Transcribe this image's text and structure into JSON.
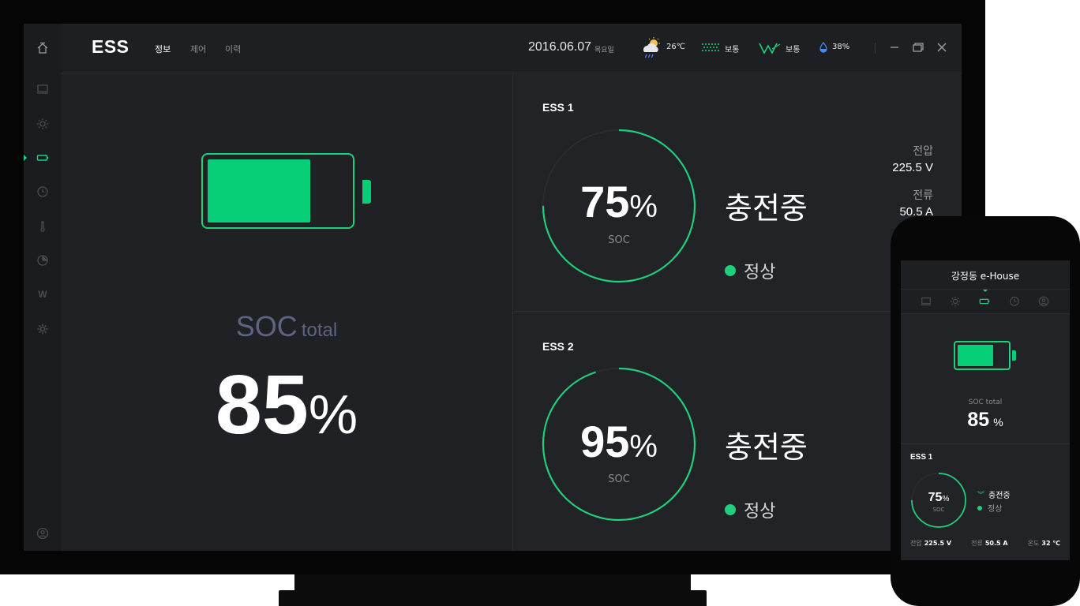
{
  "header": {
    "title": "ESS",
    "tabs": [
      {
        "label": "정보",
        "active": true
      },
      {
        "label": "제어",
        "active": false
      },
      {
        "label": "이력",
        "active": false
      }
    ],
    "date": "2016.06.07",
    "day": "목요일",
    "weather": {
      "temperature": "26℃",
      "dust_status": "보통",
      "wind_status": "보통",
      "humidity": "38%"
    }
  },
  "sidebar": {
    "items": [
      {
        "icon": "home-icon"
      },
      {
        "icon": "monitor-icon"
      },
      {
        "icon": "sun-icon"
      },
      {
        "icon": "battery-icon",
        "active": true
      },
      {
        "icon": "clock-icon"
      },
      {
        "icon": "thermometer-icon"
      },
      {
        "icon": "pie-icon"
      },
      {
        "icon": "w-icon",
        "label": "W"
      },
      {
        "icon": "gear-icon"
      },
      {
        "icon": "user-icon"
      }
    ]
  },
  "total": {
    "label": "SOC",
    "label_sub": "total",
    "value": "85",
    "unit": "%",
    "level": 0.7
  },
  "units": [
    {
      "name": "ESS 1",
      "soc": "75",
      "unit": "%",
      "soc_label": "SOC",
      "soc_fraction": 0.75,
      "status": "충전중",
      "health": "정상",
      "voltage_label": "전압",
      "voltage": "225.5 V",
      "current_label": "전류",
      "current": "50.5 A"
    },
    {
      "name": "ESS 2",
      "soc": "95",
      "unit": "%",
      "soc_label": "SOC",
      "soc_fraction": 0.95,
      "status": "충전중",
      "health": "정상"
    }
  ],
  "phone": {
    "title": "강정동 e-House",
    "soc_label": "SOC total",
    "soc_value": "85",
    "soc_unit": "%",
    "battery_level": 0.7,
    "ess_name": "ESS 1",
    "ring_value": "75",
    "ring_unit": "%",
    "ring_label": "SOC",
    "ring_fraction": 0.75,
    "status": "충전중",
    "health": "정상",
    "metrics": [
      {
        "label": "전압",
        "value": "225.5 V"
      },
      {
        "label": "전류",
        "value": "50.5 A"
      },
      {
        "label": "온도",
        "value": "32 ℃"
      }
    ]
  },
  "colors": {
    "accent": "#1fcf7b",
    "background": "#202124",
    "muted": "#5d6380"
  }
}
